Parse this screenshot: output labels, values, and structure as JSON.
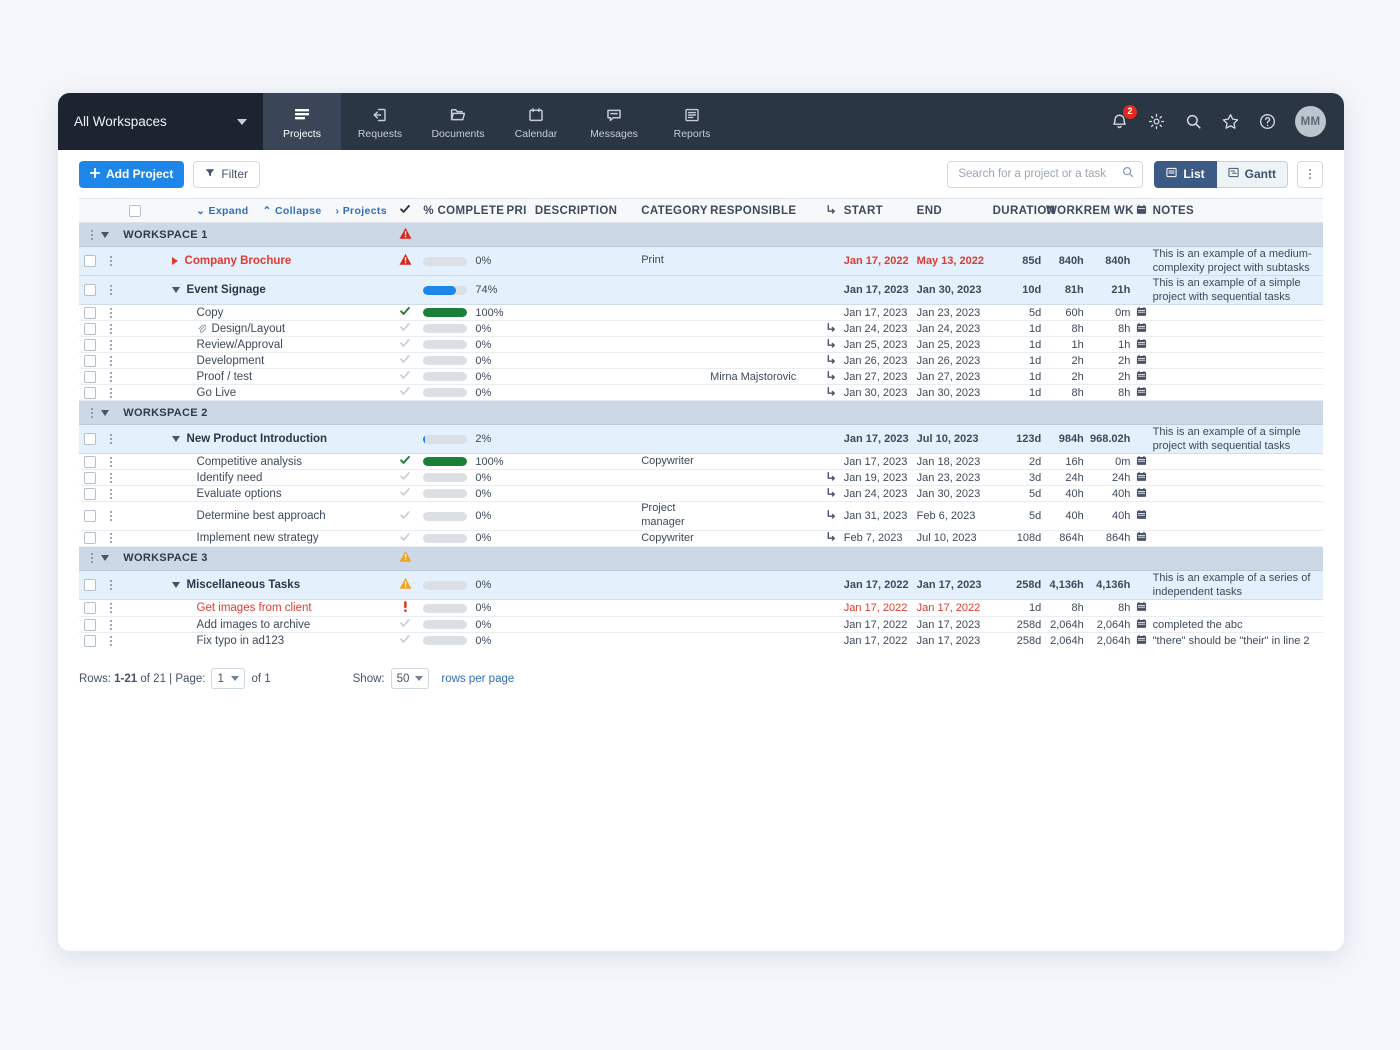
{
  "topnav": {
    "workspace_selector": "All Workspaces",
    "items": [
      {
        "label": "Projects",
        "icon": "projects-icon",
        "active": true
      },
      {
        "label": "Requests",
        "icon": "requests-icon",
        "active": false
      },
      {
        "label": "Documents",
        "icon": "documents-icon",
        "active": false
      },
      {
        "label": "Calendar",
        "icon": "calendar-icon",
        "active": false
      },
      {
        "label": "Messages",
        "icon": "messages-icon",
        "active": false
      },
      {
        "label": "Reports",
        "icon": "reports-icon",
        "active": false
      }
    ],
    "notification_count": "2",
    "avatar_initials": "MM"
  },
  "toolbar": {
    "add_project_label": "Add Project",
    "filter_label": "Filter",
    "search_placeholder": "Search for a project or a task",
    "search_value": "",
    "view_list_label": "List",
    "view_gantt_label": "Gantt",
    "active_view": "List"
  },
  "table": {
    "controls": {
      "expand_label": "Expand",
      "collapse_label": "Collapse",
      "projects_label": "Projects"
    },
    "headers": {
      "complete": "% COMPLETE",
      "pri": "PRI",
      "description": "DESCRIPTION",
      "category": "CATEGORY",
      "responsible": "RESPONSIBLE",
      "start": "START",
      "end": "END",
      "duration": "DURATION",
      "work": "WORK",
      "rem_wk": "REM WK",
      "notes": "NOTES"
    },
    "rows": [
      {
        "kind": "workspace",
        "name": "WORKSPACE 1",
        "status_icon": "alert-triangle-red"
      },
      {
        "kind": "project",
        "name": "Company Brochure",
        "name_color": "red",
        "expanded": false,
        "status_icon": "alert-triangle-red",
        "percent": 0,
        "percent_label": "0%",
        "bar_color": "#dcdfe4",
        "pri": "",
        "description": "",
        "category": "Print",
        "responsible": "",
        "dependency": false,
        "start": "Jan 17, 2022",
        "end": "May 13, 2022",
        "date_color": "red",
        "duration": "85d",
        "work": "840h",
        "rem_wk": "840h",
        "calendar": false,
        "notes": "This is an example of a medium-complexity project with subtasks"
      },
      {
        "kind": "project",
        "name": "Event Signage",
        "name_color": "dark",
        "expanded": true,
        "status_icon": "",
        "percent": 74,
        "percent_label": "74%",
        "bar_color": "#1d86e8",
        "pri": "",
        "description": "",
        "category": "",
        "responsible": "",
        "dependency": false,
        "start": "Jan 17, 2023",
        "end": "Jan 30, 2023",
        "date_color": "dark",
        "duration": "10d",
        "work": "81h",
        "rem_wk": "21h",
        "calendar": false,
        "notes": "This is an example of a simple project with sequential tasks"
      },
      {
        "kind": "task",
        "name": "Copy",
        "name_color": "dark",
        "attachment": false,
        "check": "done",
        "percent": 100,
        "percent_label": "100%",
        "bar_color": "#1a7f37",
        "category": "",
        "responsible": "",
        "dependency": false,
        "start": "Jan 17, 2023",
        "end": "Jan 23, 2023",
        "date_color": "dark",
        "duration": "5d",
        "work": "60h",
        "rem_wk": "0m",
        "calendar": true,
        "notes": ""
      },
      {
        "kind": "task",
        "name": "Design/Layout",
        "name_color": "dark",
        "attachment": true,
        "check": "todo",
        "percent": 0,
        "percent_label": "0%",
        "bar_color": "#dcdfe4",
        "category": "",
        "responsible": "",
        "dependency": true,
        "start": "Jan 24, 2023",
        "end": "Jan 24, 2023",
        "date_color": "dark",
        "duration": "1d",
        "work": "8h",
        "rem_wk": "8h",
        "calendar": true,
        "notes": ""
      },
      {
        "kind": "task",
        "name": "Review/Approval",
        "name_color": "dark",
        "attachment": false,
        "check": "todo",
        "percent": 0,
        "percent_label": "0%",
        "bar_color": "#dcdfe4",
        "category": "",
        "responsible": "",
        "dependency": true,
        "start": "Jan 25, 2023",
        "end": "Jan 25, 2023",
        "date_color": "dark",
        "duration": "1d",
        "work": "1h",
        "rem_wk": "1h",
        "calendar": true,
        "notes": ""
      },
      {
        "kind": "task",
        "name": "Development",
        "name_color": "dark",
        "attachment": false,
        "check": "todo",
        "percent": 0,
        "percent_label": "0%",
        "bar_color": "#dcdfe4",
        "category": "",
        "responsible": "",
        "dependency": true,
        "start": "Jan 26, 2023",
        "end": "Jan 26, 2023",
        "date_color": "dark",
        "duration": "1d",
        "work": "2h",
        "rem_wk": "2h",
        "calendar": true,
        "notes": ""
      },
      {
        "kind": "task",
        "name": "Proof / test",
        "name_color": "dark",
        "attachment": false,
        "check": "todo",
        "percent": 0,
        "percent_label": "0%",
        "bar_color": "#dcdfe4",
        "category": "",
        "responsible": "Mirna Majstorovic",
        "dependency": true,
        "start": "Jan 27, 2023",
        "end": "Jan 27, 2023",
        "date_color": "dark",
        "duration": "1d",
        "work": "2h",
        "rem_wk": "2h",
        "calendar": true,
        "notes": ""
      },
      {
        "kind": "task",
        "name": "Go Live",
        "name_color": "dark",
        "attachment": false,
        "check": "todo",
        "percent": 0,
        "percent_label": "0%",
        "bar_color": "#dcdfe4",
        "category": "",
        "responsible": "",
        "dependency": true,
        "start": "Jan 30, 2023",
        "end": "Jan 30, 2023",
        "date_color": "dark",
        "duration": "1d",
        "work": "8h",
        "rem_wk": "8h",
        "calendar": true,
        "notes": ""
      },
      {
        "kind": "workspace",
        "name": "WORKSPACE 2",
        "status_icon": ""
      },
      {
        "kind": "project",
        "name": "New Product Introduction",
        "name_color": "dark",
        "expanded": true,
        "status_icon": "",
        "percent": 2,
        "percent_label": "2%",
        "bar_color": "#1d86e8",
        "pri": "",
        "description": "",
        "category": "",
        "responsible": "",
        "dependency": false,
        "start": "Jan 17, 2023",
        "end": "Jul 10, 2023",
        "date_color": "dark",
        "duration": "123d",
        "work": "984h",
        "rem_wk": "968.02h",
        "calendar": false,
        "notes": "This is an example of a simple project with sequential tasks"
      },
      {
        "kind": "task",
        "name": "Competitive analysis",
        "name_color": "dark",
        "attachment": false,
        "check": "done",
        "percent": 100,
        "percent_label": "100%",
        "bar_color": "#1a7f37",
        "category": "Copywriter",
        "responsible": "",
        "dependency": false,
        "start": "Jan 17, 2023",
        "end": "Jan 18, 2023",
        "date_color": "dark",
        "duration": "2d",
        "work": "16h",
        "rem_wk": "0m",
        "calendar": true,
        "notes": ""
      },
      {
        "kind": "task",
        "name": "Identify need",
        "name_color": "dark",
        "attachment": false,
        "check": "todo",
        "percent": 0,
        "percent_label": "0%",
        "bar_color": "#dcdfe4",
        "category": "",
        "responsible": "",
        "dependency": true,
        "start": "Jan 19, 2023",
        "end": "Jan 23, 2023",
        "date_color": "dark",
        "duration": "3d",
        "work": "24h",
        "rem_wk": "24h",
        "calendar": true,
        "notes": ""
      },
      {
        "kind": "task",
        "name": "Evaluate options",
        "name_color": "dark",
        "attachment": false,
        "check": "todo",
        "percent": 0,
        "percent_label": "0%",
        "bar_color": "#dcdfe4",
        "category": "",
        "responsible": "",
        "dependency": true,
        "start": "Jan 24, 2023",
        "end": "Jan 30, 2023",
        "date_color": "dark",
        "duration": "5d",
        "work": "40h",
        "rem_wk": "40h",
        "calendar": true,
        "notes": ""
      },
      {
        "kind": "task",
        "name": "Determine best approach",
        "name_color": "dark",
        "attachment": false,
        "check": "todo",
        "percent": 0,
        "percent_label": "0%",
        "bar_color": "#dcdfe4",
        "category": "Project manager",
        "responsible": "",
        "dependency": true,
        "start": "Jan 31, 2023",
        "end": "Feb 6, 2023",
        "date_color": "dark",
        "duration": "5d",
        "work": "40h",
        "rem_wk": "40h",
        "calendar": true,
        "notes": ""
      },
      {
        "kind": "task",
        "name": "Implement new strategy",
        "name_color": "dark",
        "attachment": false,
        "check": "todo",
        "percent": 0,
        "percent_label": "0%",
        "bar_color": "#dcdfe4",
        "category": "Copywriter",
        "responsible": "",
        "dependency": true,
        "start": "Feb 7, 2023",
        "end": "Jul 10, 2023",
        "date_color": "dark",
        "duration": "108d",
        "work": "864h",
        "rem_wk": "864h",
        "calendar": true,
        "notes": ""
      },
      {
        "kind": "workspace",
        "name": "WORKSPACE 3",
        "status_icon": "alert-triangle-amber"
      },
      {
        "kind": "project",
        "name": "Miscellaneous Tasks",
        "name_color": "dark",
        "expanded": true,
        "status_icon": "alert-triangle-amber",
        "percent": 0,
        "percent_label": "0%",
        "bar_color": "#dcdfe4",
        "pri": "",
        "description": "",
        "category": "",
        "responsible": "",
        "dependency": false,
        "start": "Jan 17, 2022",
        "end": "Jan 17, 2023",
        "date_color": "dark",
        "duration": "258d",
        "work": "4,136h",
        "rem_wk": "4,136h",
        "calendar": false,
        "notes": "This is an example of a series of independent tasks"
      },
      {
        "kind": "task",
        "name": "Get images from client",
        "name_color": "red",
        "attachment": false,
        "check": "exclaim",
        "percent": 0,
        "percent_label": "0%",
        "bar_color": "#dcdfe4",
        "category": "",
        "responsible": "",
        "dependency": false,
        "start": "Jan 17, 2022",
        "end": "Jan 17, 2022",
        "date_color": "red",
        "duration": "1d",
        "work": "8h",
        "rem_wk": "8h",
        "calendar": true,
        "notes": ""
      },
      {
        "kind": "task",
        "name": "Add images to archive",
        "name_color": "dark",
        "attachment": false,
        "check": "todo",
        "percent": 0,
        "percent_label": "0%",
        "bar_color": "#dcdfe4",
        "category": "",
        "responsible": "",
        "dependency": false,
        "start": "Jan 17, 2022",
        "end": "Jan 17, 2023",
        "date_color": "dark",
        "duration": "258d",
        "work": "2,064h",
        "rem_wk": "2,064h",
        "calendar": true,
        "notes": "completed the abc"
      },
      {
        "kind": "task",
        "name": "Fix typo in ad123",
        "name_color": "dark",
        "attachment": false,
        "check": "todo",
        "percent": 0,
        "percent_label": "0%",
        "bar_color": "#dcdfe4",
        "category": "",
        "responsible": "",
        "dependency": false,
        "start": "Jan 17, 2022",
        "end": "Jan 17, 2023",
        "date_color": "dark",
        "duration": "258d",
        "work": "2,064h",
        "rem_wk": "2,064h",
        "calendar": true,
        "notes": "\"there\" should be \"their\" in line 2"
      }
    ]
  },
  "footer": {
    "rows_label": "Rows:",
    "rows_range": "1-21",
    "rows_of": "of 21",
    "separator": "|",
    "page_label": "Page:",
    "page_value": "1",
    "page_of": "of 1",
    "show_label": "Show:",
    "show_value": "50",
    "rows_per_page": "rows per page"
  },
  "colors": {
    "accent_blue": "#1d86e8",
    "done_green": "#1a7f37",
    "alert_red": "#e03b30",
    "alert_amber": "#f0a326",
    "nav_dark": "#2b3645"
  }
}
